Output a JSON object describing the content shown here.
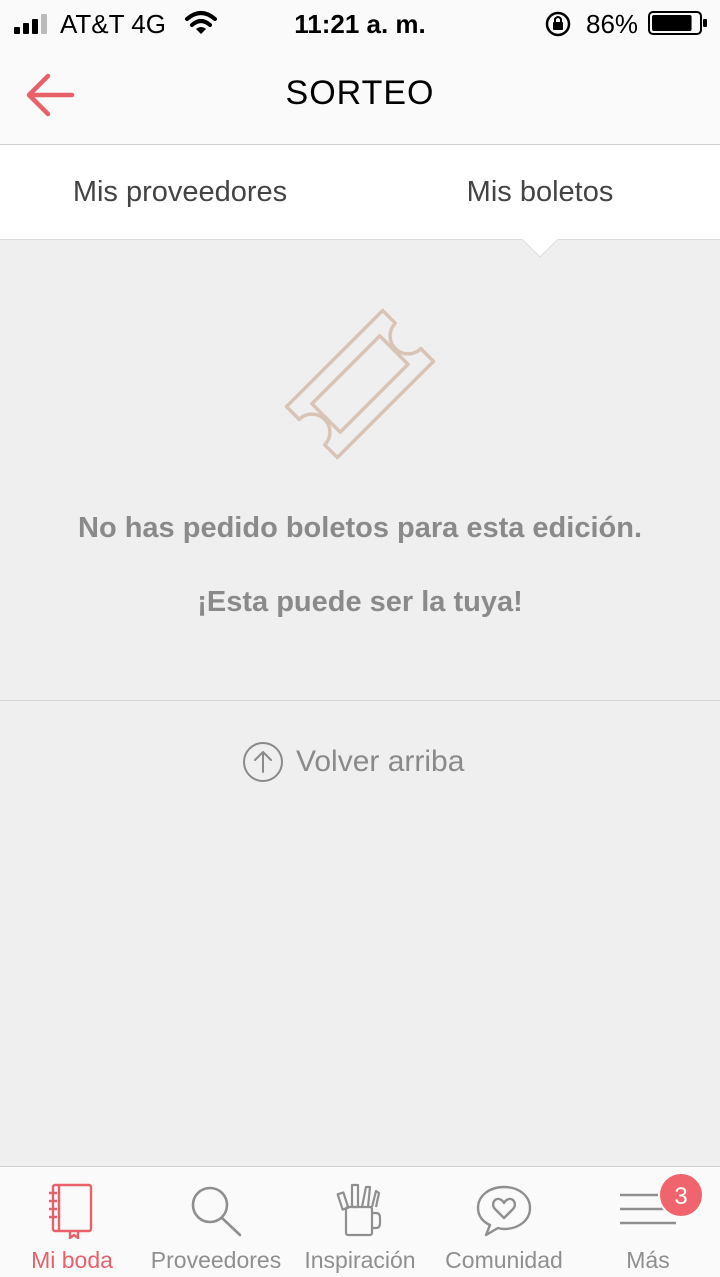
{
  "status_bar": {
    "carrier": "AT&T 4G",
    "time": "11:21 a. m.",
    "battery": "86%",
    "battery_level": 0.86
  },
  "header": {
    "title": "SORTEO",
    "back_icon": "back-arrow-icon"
  },
  "tabs": [
    {
      "label": "Mis proveedores",
      "selected": false
    },
    {
      "label": "Mis boletos",
      "selected": true
    }
  ],
  "empty_state": {
    "icon": "ticket-icon",
    "message": "No has pedido boletos para esta edición.",
    "sub_message": "¡Esta puede ser la tuya!"
  },
  "back_to_top": {
    "label": "Volver arriba",
    "icon": "arrow-up-circle-icon"
  },
  "bottom_nav": {
    "items": [
      {
        "label": "Mi boda",
        "icon": "notebook-icon",
        "active": true
      },
      {
        "label": "Proveedores",
        "icon": "search-icon",
        "active": false
      },
      {
        "label": "Inspiración",
        "icon": "pencil-cup-icon",
        "active": false
      },
      {
        "label": "Comunidad",
        "icon": "heart-chat-icon",
        "active": false
      },
      {
        "label": "Más",
        "icon": "menu-icon",
        "active": false
      }
    ],
    "badge_count": "3"
  },
  "colors": {
    "accent": "#e8616a",
    "icon_tan": "#d8c4b6",
    "muted_text": "#8a8a8a",
    "background": "#efefef"
  }
}
